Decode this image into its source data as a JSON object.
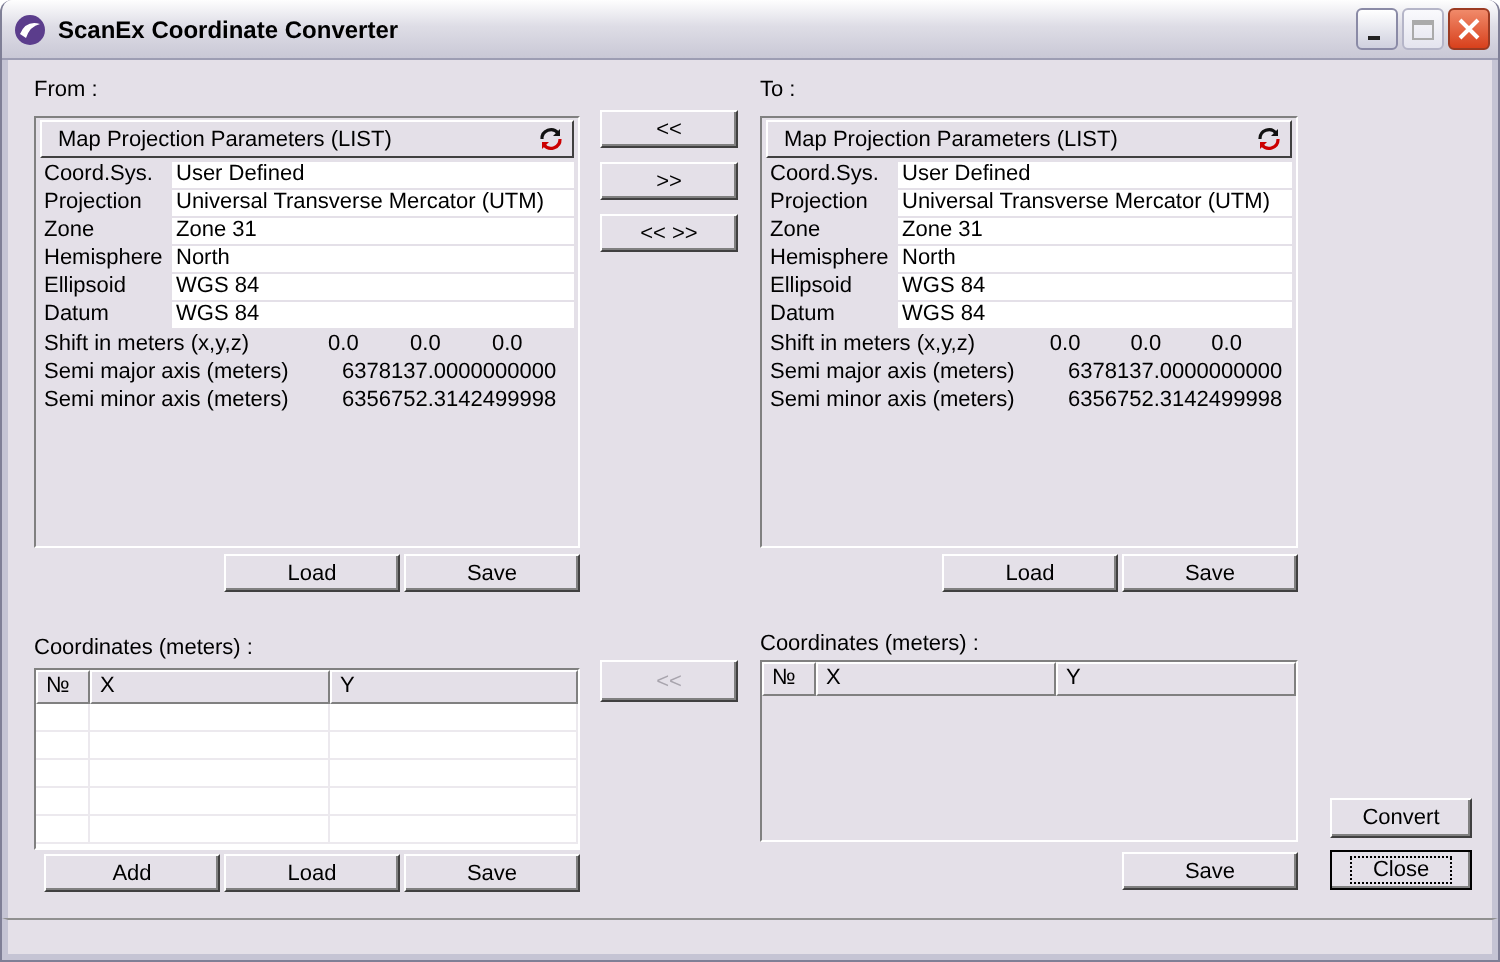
{
  "window": {
    "title": "ScanEx Coordinate Converter"
  },
  "sides": [
    {
      "label": "From :",
      "panel": {
        "title": "Map Projection Parameters (LIST)",
        "fields": [
          {
            "label": "Coord.Sys.",
            "value": "User Defined"
          },
          {
            "label": "Projection",
            "value": "Universal Transverse Mercator (UTM)"
          },
          {
            "label": "Zone",
            "value": "Zone 31"
          },
          {
            "label": "Hemisphere",
            "value": "North"
          },
          {
            "label": "Ellipsoid",
            "value": "WGS 84"
          },
          {
            "label": "Datum",
            "value": "WGS 84"
          }
        ],
        "readouts": [
          {
            "label": "Shift in meters (x,y,z)",
            "values": [
              "0.0",
              "0.0",
              "0.0"
            ]
          },
          {
            "label": "Semi major axis (meters)",
            "values": [
              "6378137.0000000000"
            ]
          },
          {
            "label": "Semi minor axis (meters)",
            "values": [
              "6356752.3142499998"
            ]
          }
        ]
      },
      "panel_buttons": [
        "Load",
        "Save"
      ],
      "coordinates": {
        "label": "Coordinates (meters) :",
        "columns": [
          "№",
          "X",
          "Y"
        ],
        "grid": true
      },
      "coordinate_buttons": [
        "Add",
        "Load",
        "Save"
      ]
    },
    {
      "label": "To :",
      "panel": {
        "title": "Map Projection Parameters (LIST)",
        "fields": [
          {
            "label": "Coord.Sys.",
            "value": "User Defined"
          },
          {
            "label": "Projection",
            "value": "Universal Transverse Mercator (UTM)"
          },
          {
            "label": "Zone",
            "value": "Zone 31"
          },
          {
            "label": "Hemisphere",
            "value": "North"
          },
          {
            "label": "Ellipsoid",
            "value": "WGS 84"
          },
          {
            "label": "Datum",
            "value": "WGS 84"
          }
        ],
        "readouts": [
          {
            "label": "Shift in meters (x,y,z)",
            "values": [
              "0.0",
              "0.0",
              "0.0"
            ]
          },
          {
            "label": "Semi major axis (meters)",
            "values": [
              "6378137.0000000000"
            ]
          },
          {
            "label": "Semi minor axis (meters)",
            "values": [
              "6356752.3142499998"
            ]
          }
        ]
      },
      "panel_buttons": [
        "Load",
        "Save"
      ],
      "coordinates": {
        "label": "Coordinates (meters) :",
        "columns": [
          "№",
          "X",
          "Y"
        ],
        "grid": false
      },
      "coordinate_buttons": [
        "Save"
      ]
    }
  ],
  "transfer_buttons": [
    {
      "label": "<<",
      "disabled": false
    },
    {
      "label": ">>",
      "disabled": false
    },
    {
      "label": "<< >>",
      "disabled": false
    }
  ],
  "copy_button": {
    "label": "<<",
    "disabled": true
  },
  "actions": [
    {
      "label": "Convert",
      "focused": false
    },
    {
      "label": "Close",
      "focused": true
    }
  ]
}
